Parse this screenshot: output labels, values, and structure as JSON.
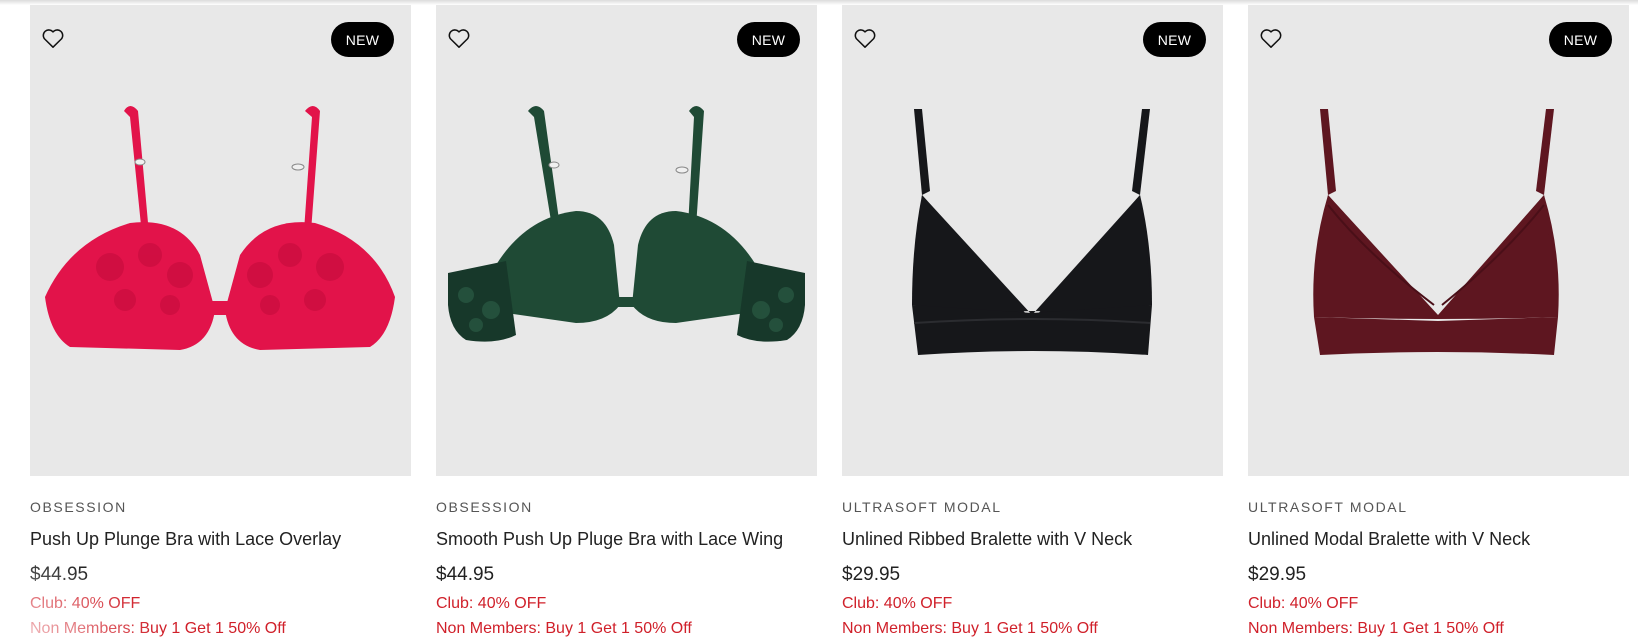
{
  "products": [
    {
      "badge": "NEW",
      "brand": "OBSESSION",
      "name": "Push Up Plunge Bra with Lace Overlay",
      "price": "$44.95",
      "promo_club": "Club: 40% OFF",
      "promo_nonmember": "Non Members: Buy 1 Get 1 50% Off",
      "color": "#e2134a",
      "image": "push-up-plunge-lace-bra"
    },
    {
      "badge": "NEW",
      "brand": "OBSESSION",
      "name": "Smooth Push Up Pluge Bra with Lace Wing",
      "price": "$44.95",
      "promo_club": "Club: 40% OFF",
      "promo_nonmember": "Non Members: Buy 1 Get 1 50% Off",
      "color": "#1f4a35",
      "image": "smooth-push-up-lace-wing-bra"
    },
    {
      "badge": "NEW",
      "brand": "ULTRASOFT MODAL",
      "name": "Unlined Ribbed Bralette with V Neck",
      "price": "$29.95",
      "promo_club": "Club: 40% OFF",
      "promo_nonmember": "Non Members: Buy 1 Get 1 50% Off",
      "color": "#16171a",
      "image": "ribbed-v-neck-bralette"
    },
    {
      "badge": "NEW",
      "brand": "ULTRASOFT MODAL",
      "name": "Unlined Modal Bralette with V Neck",
      "price": "$29.95",
      "promo_club": "Club: 40% OFF",
      "promo_nonmember": "Non Members: Buy 1 Get 1 50% Off",
      "color": "#5e1620",
      "image": "modal-v-neck-bralette"
    }
  ],
  "icons": {
    "wishlist": "heart-outline-icon"
  },
  "colors": {
    "promo_red": "#d0202a",
    "badge_bg": "#000000",
    "image_bg": "#e8e8e8"
  }
}
